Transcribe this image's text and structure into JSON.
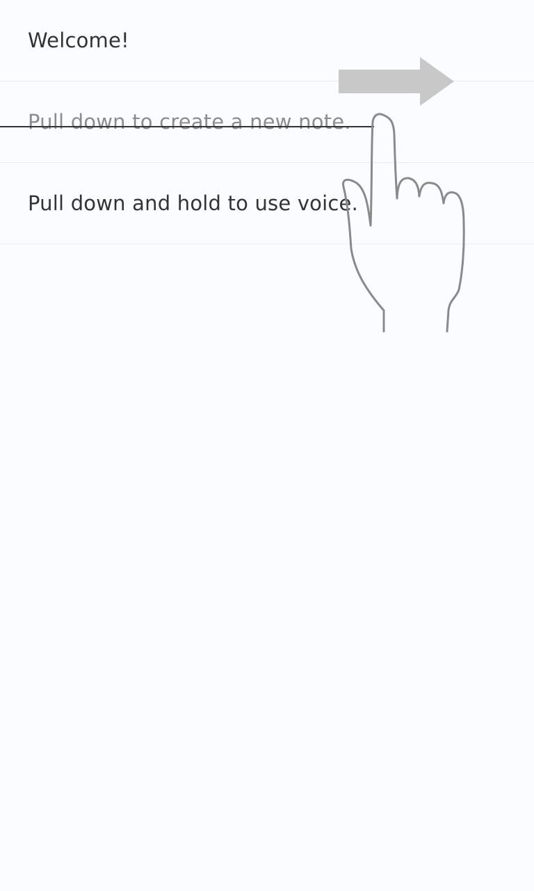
{
  "notes": [
    {
      "text": "Welcome!",
      "completed": false
    },
    {
      "text": "Pull down to create a new note.",
      "completed": true
    },
    {
      "text": "Pull down and hold to use voice.",
      "completed": false
    }
  ],
  "colors": {
    "background": "#fbfcff",
    "divider": "#e9ebef",
    "text": "#333333",
    "completed_text": "#8c8c8c",
    "arrow": "#c8c8c8",
    "hand_outline": "#8a8a8a"
  },
  "icons": {
    "gesture_arrow": "swipe-right-arrow-icon",
    "gesture_hand": "pointing-hand-icon"
  }
}
